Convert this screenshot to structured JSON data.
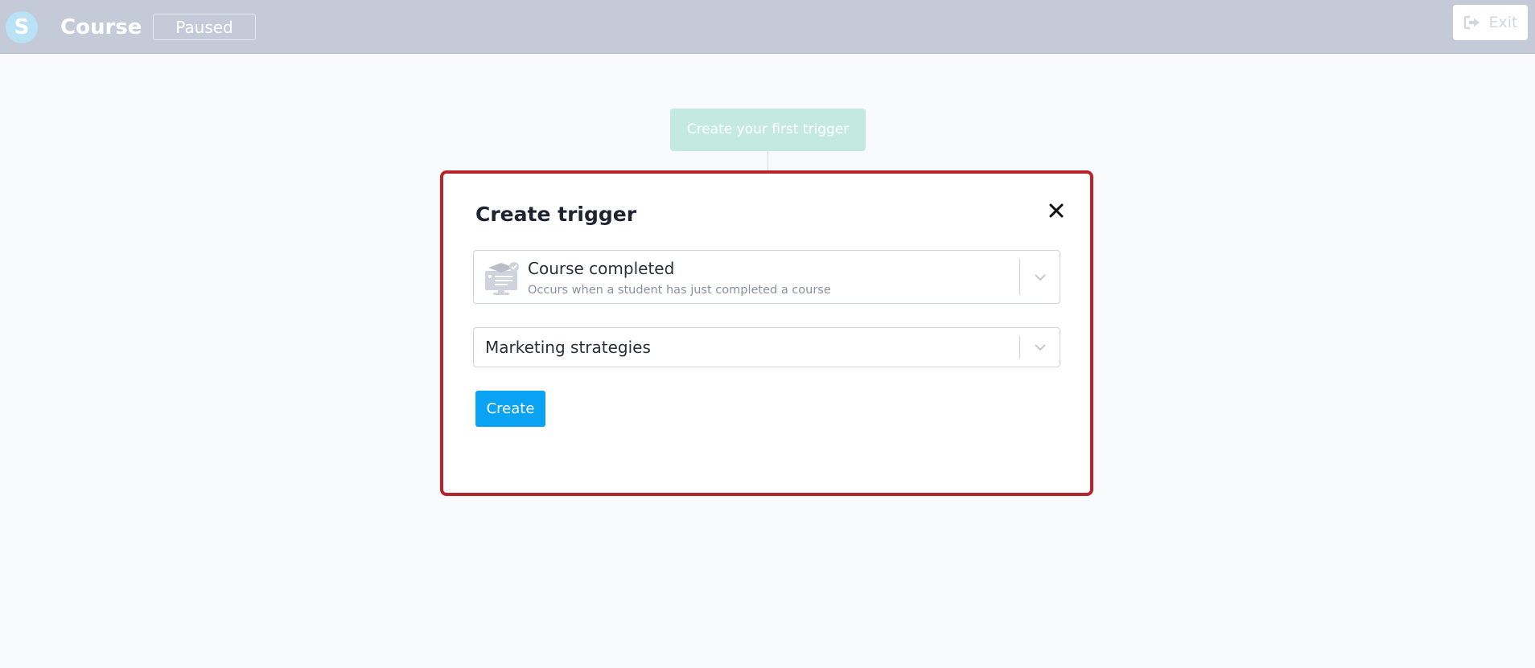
{
  "header": {
    "logo_letter": "S",
    "title": "Course",
    "status": "Paused",
    "exit_label": "Exit",
    "exit_icon": "sign-out-icon"
  },
  "canvas": {
    "placeholder_label": "Create your first trigger"
  },
  "modal": {
    "title": "Create trigger",
    "close_icon": "close-icon",
    "trigger_select": {
      "icon": "course-certificate-icon",
      "label": "Course completed",
      "description": "Occurs when a student has just completed a course"
    },
    "course_select": {
      "value": "Marketing strategies"
    },
    "create_label": "Create"
  },
  "colors": {
    "header_bg": "#c4cad8",
    "accent": "#0aa2f2",
    "highlight_border": "#b8232a",
    "placeholder_bg": "#c3e9e0"
  }
}
